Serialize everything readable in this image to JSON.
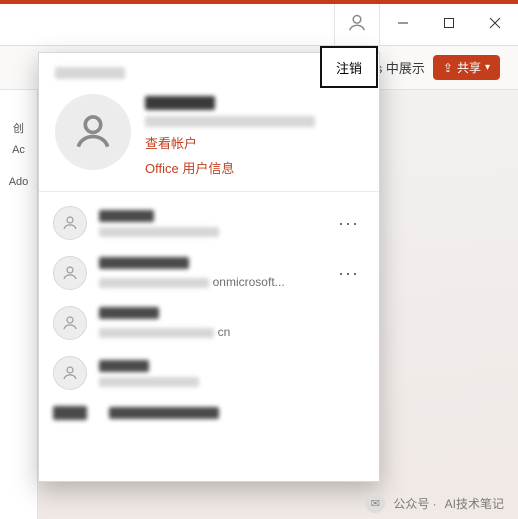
{
  "titlebar": {
    "minimize": "—",
    "maximize": "□",
    "close": "✕"
  },
  "ribbon": {
    "truncated_label": "s 中展示",
    "share_label": "共享"
  },
  "left_strip": {
    "s1": "创",
    "s2": "Ac",
    "s3": "Ado"
  },
  "account_flyout": {
    "logout_label": "注销",
    "view_account_label": "查看帐户",
    "office_userinfo_label": "Office 用户信息",
    "accounts": [
      {
        "email_fragment": ""
      },
      {
        "email_fragment": "onmicrosoft..."
      },
      {
        "email_fragment": "cn"
      },
      {
        "email_fragment": ""
      }
    ],
    "more": "···"
  },
  "watermark": {
    "prefix": "公众号 ·",
    "name": "AI技术笔记"
  }
}
